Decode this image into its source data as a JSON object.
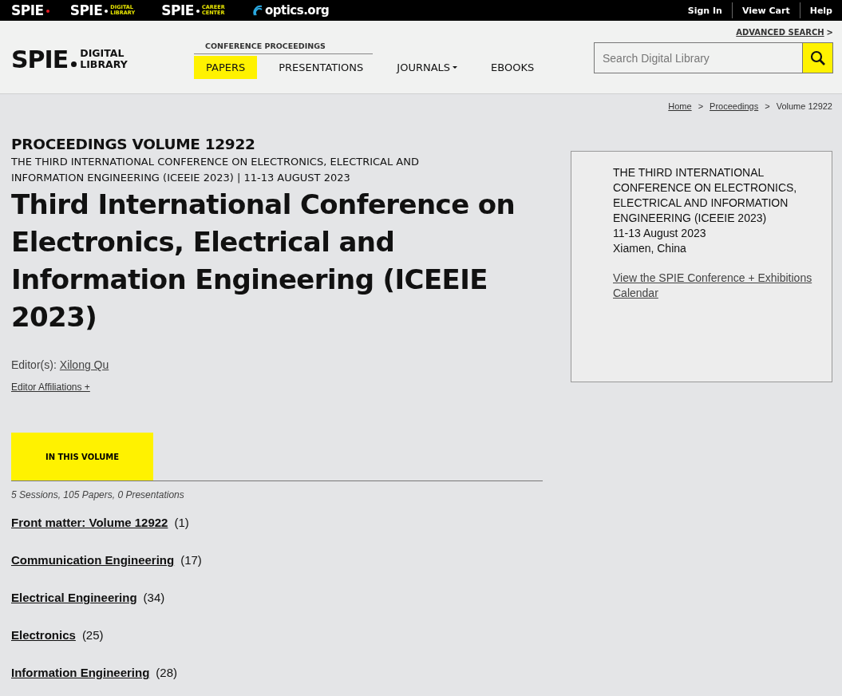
{
  "top_bar": {
    "brands": [
      {
        "kind": "spie",
        "name": "SPIE"
      },
      {
        "kind": "spie-sub",
        "name": "SPIE",
        "tagline": "DIGITAL LIBRARY"
      },
      {
        "kind": "spie-sub",
        "name": "SPIE",
        "tagline": "CAREER CENTER"
      },
      {
        "kind": "optics",
        "name": "optics.org"
      }
    ],
    "links": [
      "Sign In",
      "View Cart",
      "Help"
    ]
  },
  "header": {
    "logo": {
      "name": "SPIE",
      "tagline": "DIGITAL LIBRARY"
    },
    "nav_heading": "CONFERENCE PROCEEDINGS",
    "tabs": [
      {
        "label": "PAPERS",
        "selected": true,
        "dropdown": false
      },
      {
        "label": "PRESENTATIONS",
        "selected": false,
        "dropdown": false
      },
      {
        "label": "JOURNALS",
        "selected": false,
        "dropdown": true
      },
      {
        "label": "EBOOKS",
        "selected": false,
        "dropdown": false
      }
    ],
    "advanced_search": "ADVANCED SEARCH",
    "advanced_search_arrow": ">",
    "search": {
      "placeholder": "Search Digital Library"
    }
  },
  "breadcrumbs": [
    {
      "label": "Home",
      "link": true
    },
    {
      "label": "Proceedings",
      "link": true
    },
    {
      "label": "Volume 12922",
      "link": false
    }
  ],
  "breadcrumb_separator": ">",
  "volume": {
    "label": "PROCEEDINGS VOLUME 12922",
    "conference_line": "THE THIRD INTERNATIONAL CONFERENCE ON ELECTRONICS, ELECTRICAL AND INFORMATION ENGINEERING (ICEEIE 2023) | 11-13 AUGUST 2023",
    "title": "Third International Conference on Electronics, Electrical and Information Engineering (ICEEIE 2023)",
    "editors_label": "Editor(s):",
    "editor": "Xilong Qu",
    "affiliations": "Editor Affiliations +"
  },
  "section_tab": {
    "label": "IN THIS VOLUME",
    "selected": true
  },
  "summary": "5 Sessions, 105 Papers, 0 Presentations",
  "sessions": [
    {
      "title": "Front matter: Volume 12922",
      "count": "(1)"
    },
    {
      "title": "Communication Engineering",
      "count": "(17)"
    },
    {
      "title": "Electrical Engineering",
      "count": "(34)"
    },
    {
      "title": "Electronics",
      "count": "(25)"
    },
    {
      "title": "Information Engineering",
      "count": "(28)"
    }
  ],
  "conference_card": {
    "lines": [
      "THE THIRD INTERNATIONAL CONFERENCE ON ELECTRONICS, ELECTRICAL AND INFORMATION ENGINEERING (ICEEIE 2023)",
      "11-13 August 2023",
      "Xiamen, China"
    ],
    "link": "View the SPIE Conference + Exhibitions Calendar"
  }
}
